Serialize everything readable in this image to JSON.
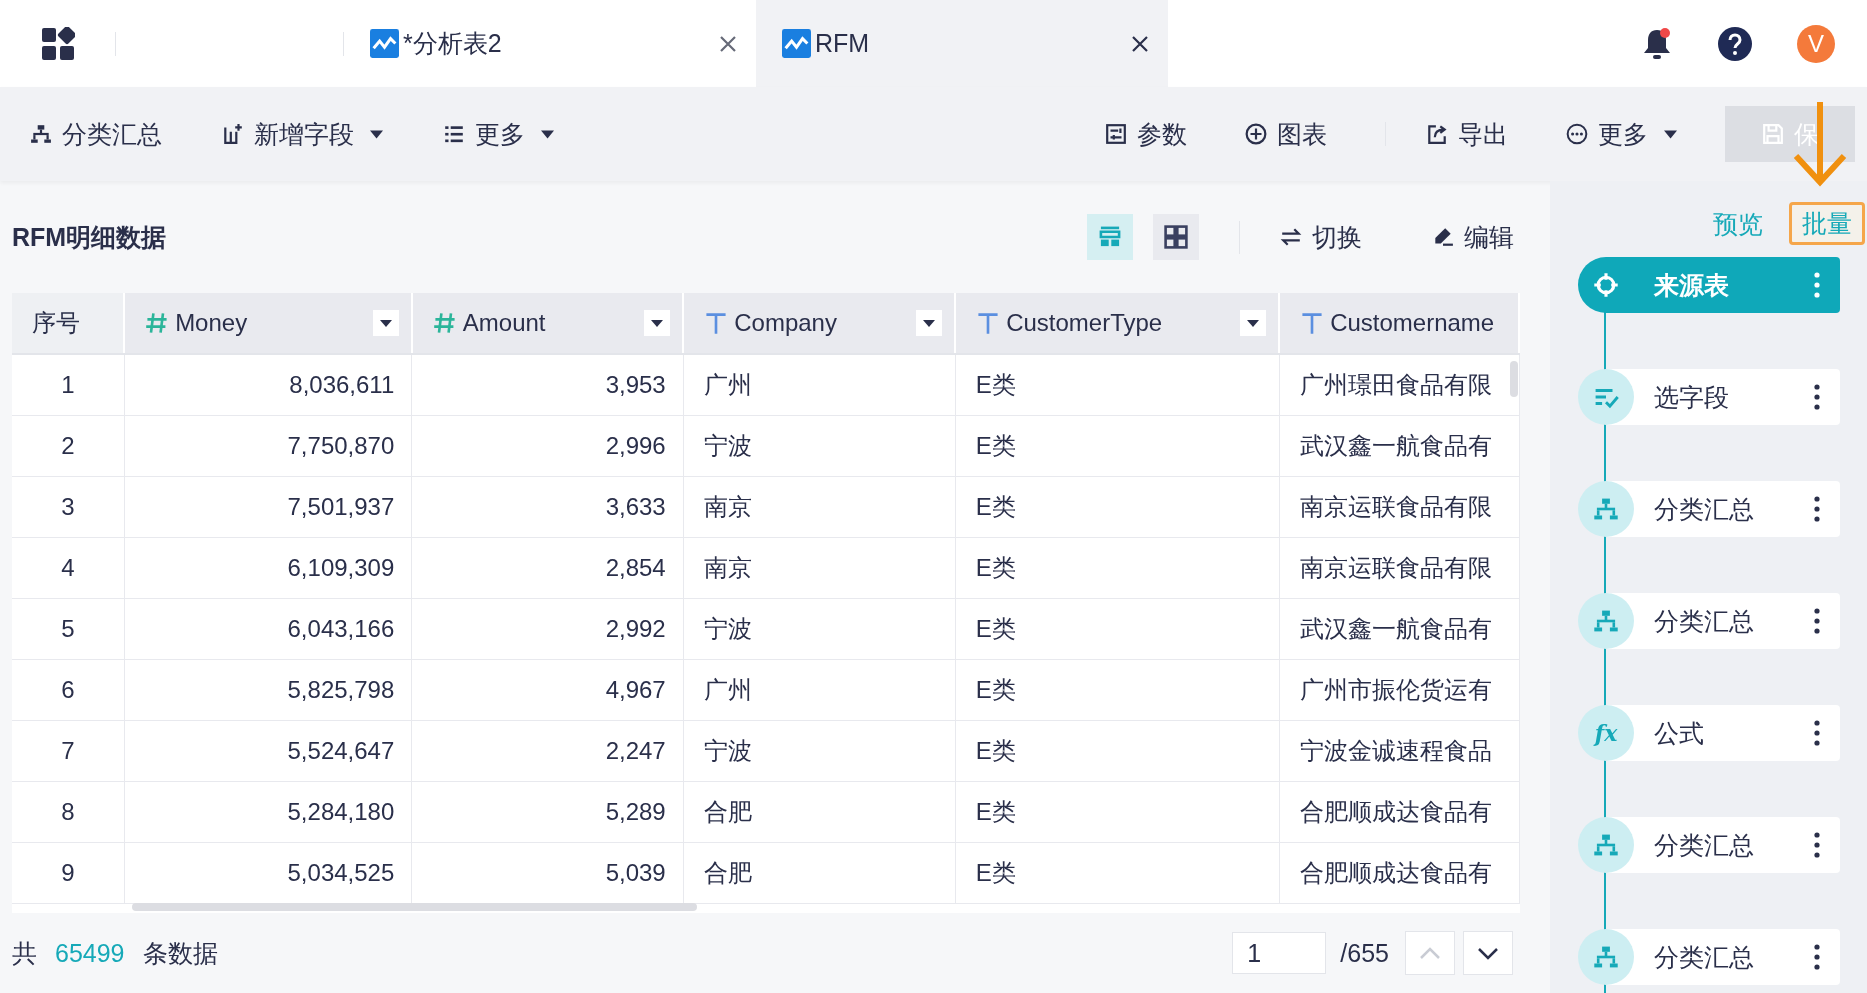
{
  "top_bar": {
    "tabs": [
      {
        "title": "*分析表2",
        "selected": false
      },
      {
        "title": "RFM",
        "selected": true
      }
    ],
    "avatar": "V"
  },
  "toolbar": {
    "left": [
      {
        "label": "分类汇总",
        "kind": "group",
        "dropdown": false
      },
      {
        "label": "新增字段",
        "kind": "add-field",
        "dropdown": true
      },
      {
        "label": "更多",
        "kind": "list",
        "dropdown": true
      }
    ],
    "right": [
      {
        "label": "参数",
        "kind": "param",
        "dropdown": false
      },
      {
        "label": "图表",
        "kind": "plus",
        "dropdown": false
      },
      {
        "label": "导出",
        "kind": "export",
        "dropdown": false
      },
      {
        "label": "更多",
        "kind": "more",
        "dropdown": true
      }
    ],
    "save": {
      "label": "保",
      "disabled": true
    }
  },
  "dataset": {
    "title": "RFM明细数据",
    "views": [
      {
        "kind": "list",
        "selected": true
      },
      {
        "kind": "grid",
        "selected": false
      }
    ],
    "actions": [
      {
        "label": "切换",
        "kind": "swap"
      },
      {
        "label": "编辑",
        "kind": "edit"
      }
    ]
  },
  "table": {
    "columns": [
      {
        "label": "序号",
        "kind": "index"
      },
      {
        "label": "Money",
        "kind": "number"
      },
      {
        "label": "Amount",
        "kind": "number"
      },
      {
        "label": "Company",
        "kind": "text"
      },
      {
        "label": "CustomerType",
        "kind": "text"
      },
      {
        "label": "Customername",
        "kind": "text"
      }
    ],
    "rows": [
      [
        "1",
        "8,036,611",
        "3,953",
        "广州",
        "E类",
        "广州璟田食品有限"
      ],
      [
        "2",
        "7,750,870",
        "2,996",
        "宁波",
        "E类",
        "武汉鑫一航食品有"
      ],
      [
        "3",
        "7,501,937",
        "3,633",
        "南京",
        "E类",
        "南京运联食品有限"
      ],
      [
        "4",
        "6,109,309",
        "2,854",
        "南京",
        "E类",
        "南京运联食品有限"
      ],
      [
        "5",
        "6,043,166",
        "2,992",
        "宁波",
        "E类",
        "武汉鑫一航食品有"
      ],
      [
        "6",
        "5,825,798",
        "4,967",
        "广州",
        "E类",
        "广州市振伦货运有"
      ],
      [
        "7",
        "5,524,647",
        "2,247",
        "宁波",
        "E类",
        "宁波金诚速程食品"
      ],
      [
        "8",
        "5,284,180",
        "5,289",
        "合肥",
        "E类",
        "合肥顺成达食品有"
      ],
      [
        "9",
        "5,034,525",
        "5,039",
        "合肥",
        "E类",
        "合肥顺成达食品有"
      ]
    ]
  },
  "footer": {
    "prefix": "共",
    "count": "65499",
    "suffix": "条数据",
    "page": "1",
    "total": "/655",
    "prev_disabled": true,
    "next_disabled": false
  },
  "flow": {
    "preview": "预览",
    "batch": {
      "label": "批量",
      "highlighted": true
    },
    "nodes": [
      {
        "kind": "source",
        "label": "来源表",
        "selected": true
      },
      {
        "kind": "select",
        "label": "选字段",
        "selected": false
      },
      {
        "kind": "group",
        "label": "分类汇总",
        "selected": false
      },
      {
        "kind": "group",
        "label": "分类汇总",
        "selected": false
      },
      {
        "kind": "formula",
        "label": "公式",
        "icon_text": "fx",
        "selected": false
      },
      {
        "kind": "group",
        "label": "分类汇总",
        "selected": false
      },
      {
        "kind": "group",
        "label": "分类汇总",
        "selected": false
      }
    ]
  }
}
